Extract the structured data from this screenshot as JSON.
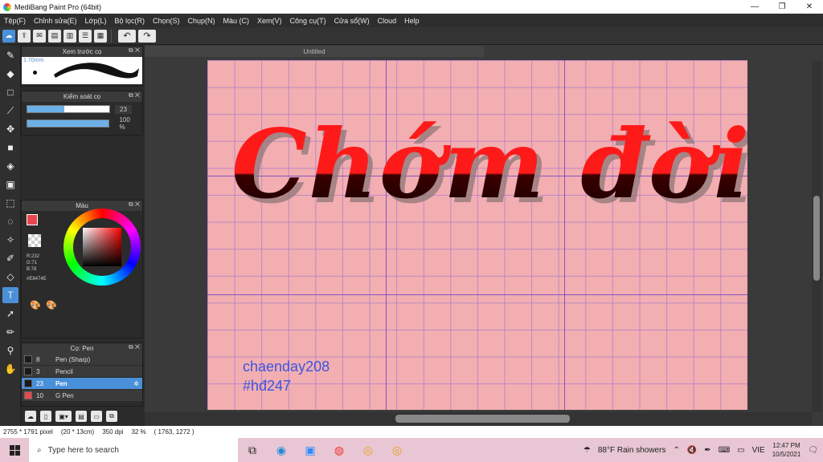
{
  "window": {
    "title": "MediBang Paint Pro (64bit)",
    "min": "—",
    "max": "❐",
    "close": "✕"
  },
  "menu": [
    "Tệp(F)",
    "Chỉnh sửa(E)",
    "Lớp(L)",
    "Bộ lọc(R)",
    "Chọn(S)",
    "Chụp(N)",
    "Màu (C)",
    "Xem(V)",
    "Công cụ(T)",
    "Cửa sổ(W)",
    "Cloud",
    "Help"
  ],
  "document": {
    "tab_title": "Untitled"
  },
  "brush_preview": {
    "title": "Xem trước cọ",
    "size": "1.70mm"
  },
  "brush_control": {
    "title": "Kiểm soát cọ",
    "size_value": "23",
    "opacity_value": "100 %",
    "size_fraction": 0.45,
    "opacity_fraction": 1.0
  },
  "color_panel": {
    "title": "Màu",
    "rgb": "R:232\nG:71\nB:78",
    "hex": "#E8474E",
    "primary": "#E8474E"
  },
  "pen_panel": {
    "title": "Cọ: Pen",
    "items": [
      {
        "num": "8",
        "name": "Pen (Sharp)",
        "swatch": "#1a1a1a"
      },
      {
        "num": "3",
        "name": "Pencil",
        "swatch": "#1a1a1a"
      },
      {
        "num": "23",
        "name": "Pen",
        "swatch": "#1a1a1a"
      },
      {
        "num": "10",
        "name": "G Pen",
        "swatch": "#e8474e"
      }
    ]
  },
  "artwork": {
    "title": "Chớm đời",
    "signature_1": "chaenday208",
    "signature_2": "#hđ247"
  },
  "status": {
    "dimensions": "2755 * 1791 pixel",
    "size": "(20 * 13cm)",
    "dpi": "350 dpi",
    "zoom": "32 %",
    "coords": "( 1763, 1272 )"
  },
  "taskbar": {
    "search_placeholder": "Type here to search",
    "weather": "88°F  Rain showers",
    "lang": "VIE",
    "time": "12:47 PM",
    "date": "10/5/2021"
  }
}
